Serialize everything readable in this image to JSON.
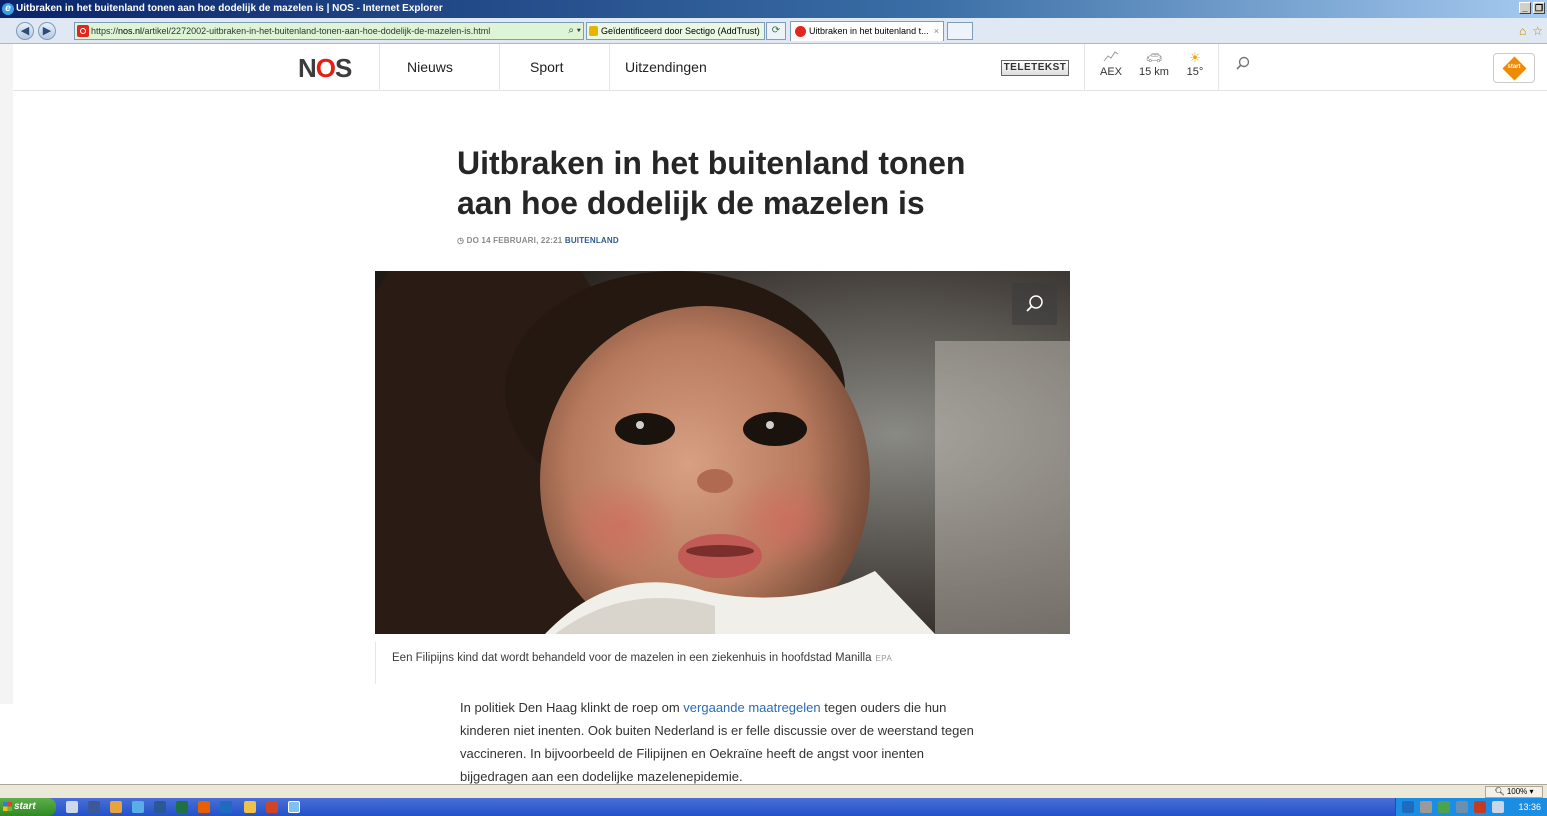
{
  "window": {
    "title": "Uitbraken in het buitenland tonen aan hoe dodelijk de mazelen is | NOS - Internet Explorer"
  },
  "addressbar": {
    "url_prefix": "https://",
    "url_domain": "nos.nl",
    "url_path": "/artikel/2272002-uitbraken-in-het-buitenland-tonen-aan-hoe-dodelijk-de-mazelen-is.html",
    "security_text": "Geïdentificeerd door Sectigo (AddTrust)",
    "tab_title": "Uitbraken in het buitenland t...",
    "tab_close": "×"
  },
  "header": {
    "logo_n": "N",
    "logo_o": "O",
    "logo_s": "S",
    "nav": [
      "Nieuws",
      "Sport",
      "Uitzendingen"
    ],
    "teletekst_label": "TELETEKST",
    "widgets": [
      {
        "label": "AEX",
        "icon": "chart-icon"
      },
      {
        "label": "15 km",
        "icon": "car-icon"
      },
      {
        "label": "15°",
        "icon": "weather-sun-icon"
      }
    ],
    "start_label": "start"
  },
  "article": {
    "headline": "Uitbraken in het buitenland tonen aan hoe dodelijk de mazelen is",
    "date": "DO 14 FEBRUARI, 22:21",
    "category": "BUITENLAND",
    "caption": "Een Filipijns kind dat wordt behandeld voor de mazelen in een ziekenhuis in hoofdstad Manilla",
    "credit": "EPA",
    "body_part1": "In politiek Den Haag klinkt de roep om ",
    "body_link": "vergaande maatregelen",
    "body_part2": " tegen ouders die hun kinderen niet inenten. Ook buiten Nederland is er felle discussie over de weerstand tegen vaccineren. In bijvoorbeeld de Filipijnen en Oekraïne heeft de angst voor inenten bijgedragen aan een dodelijke mazelenepidemie."
  },
  "statusbar": {
    "zoom": "100%"
  },
  "taskbar": {
    "start_label": "start",
    "clock": "13:36"
  },
  "colors": {
    "nos_red": "#e61e14",
    "link_blue": "#2a6bb3",
    "category_blue": "#2d5a94"
  }
}
